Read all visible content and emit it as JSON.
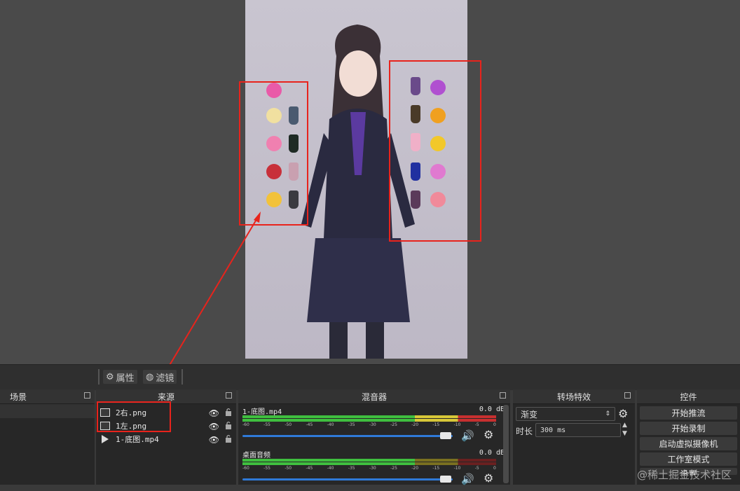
{
  "toolbar": {
    "properties_label": "属性",
    "filters_label": "滤镜"
  },
  "panels": {
    "scenes_title": "场景",
    "sources_title": "来源",
    "mixer_title": "混音器",
    "transitions_title": "转场特效",
    "controls_title": "控件"
  },
  "sources": [
    {
      "name": "2右.png"
    },
    {
      "name": "1左.png"
    },
    {
      "name": "1-底图.mp4"
    }
  ],
  "mixer": {
    "channels": [
      {
        "name": "1-底图.mp4",
        "db": "0.0 dB"
      },
      {
        "name": "桌面音频",
        "db": "0.0 dB"
      }
    ],
    "scale": [
      "-60",
      "-55",
      "-50",
      "-45",
      "-40",
      "-35",
      "-30",
      "-25",
      "-20",
      "-15",
      "-10",
      "-5",
      "0"
    ]
  },
  "transitions": {
    "selected": "渐变",
    "duration_label": "时长",
    "duration_value": "300 ms"
  },
  "controls": {
    "start_stream": "开始推流",
    "start_record": "开始录制",
    "start_virtualcam": "启动虚拟摄像机",
    "studio_mode": "工作室模式",
    "settings": "设置"
  },
  "watermark": "@稀土掘金技术社区",
  "colors": {
    "highlight": "#e8231c",
    "fader": "#2f7ad8",
    "meter_green": "#3fbf3f",
    "meter_yellow": "#d8c838",
    "meter_red": "#c83030"
  }
}
